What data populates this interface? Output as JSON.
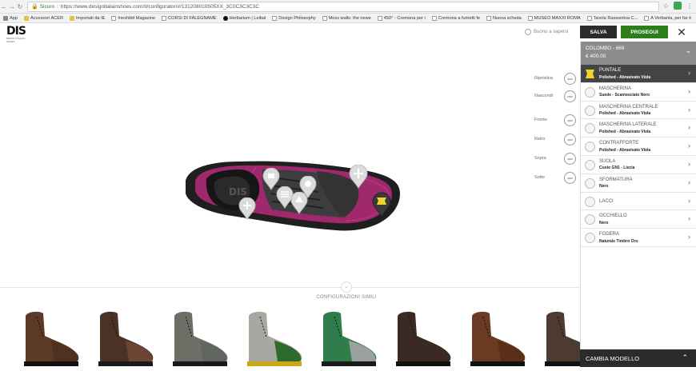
{
  "browser": {
    "secure_label": "Sicuro",
    "url": "https://www.designitalianshoes.com/it/configurator/#/131208010505XX_3C0C3C3C3C"
  },
  "bookmarks": [
    {
      "label": "App",
      "icon": "apps-grid-icon"
    },
    {
      "label": "Accessori ACER",
      "icon": "folder-icon"
    },
    {
      "label": "Importati da IE",
      "icon": "folder-icon"
    },
    {
      "label": "Inexhibit Magazine",
      "icon": "page-icon"
    },
    {
      "label": "CORSI DI FALEGNAME",
      "icon": "page-icon"
    },
    {
      "label": "Herbarium | Leibal",
      "icon": "dot-icon"
    },
    {
      "label": "Design Philosophy",
      "icon": "page-icon"
    },
    {
      "label": "Moss walls: the newe",
      "icon": "page-icon"
    },
    {
      "label": "450° - Cremona per i",
      "icon": "page-icon"
    },
    {
      "label": "Cremona a fumetti fe",
      "icon": "page-icon"
    },
    {
      "label": "Nuova scheda",
      "icon": "page-icon"
    },
    {
      "label": "MUSEO MAXXI ROMA",
      "icon": "google-icon"
    },
    {
      "label": "Tavola Rassuntiva C...",
      "icon": "page-icon"
    },
    {
      "label": "A Verbania, per far è",
      "icon": "page-icon"
    }
  ],
  "header": {
    "logo_text": "DIS",
    "logo_sub": "DESIGN ITALIAN SHOES",
    "buono_label": "Buono a sapersi",
    "salva_label": "SALVA",
    "prosegui_label": "PROSEGUI"
  },
  "tools": [
    {
      "label": "Ripristina",
      "icon": "reset-icon"
    },
    {
      "label": "Nascondi",
      "icon": "hide-pins-icon"
    },
    {
      "label": "Fronte",
      "icon": "view-front-icon"
    },
    {
      "label": "Retro",
      "icon": "view-back-icon"
    },
    {
      "label": "Sopra",
      "icon": "view-top-icon"
    },
    {
      "label": "Sotto",
      "icon": "view-bottom-icon"
    }
  ],
  "similar": {
    "title": "CONFIGURAZIONI SIMILI",
    "items": [
      {
        "upper": "#5b3a26",
        "toe": "#4e3121",
        "sole": "#111111"
      },
      {
        "upper": "#4a3226",
        "toe": "#6b4634",
        "sole": "#1a1a1a"
      },
      {
        "upper": "#6f6e66",
        "toe": "#5f6660",
        "sole": "#1a1a1a"
      },
      {
        "upper": "#a8a8a2",
        "toe": "#2d6a2b",
        "sole": "#c9a81c"
      },
      {
        "upper": "#2e7d4a",
        "toe": "#9aa0a0",
        "sole": "#1a1a1a"
      },
      {
        "upper": "#3a2a23",
        "toe": "#3a2a23",
        "sole": "#111111"
      },
      {
        "upper": "#6b3a22",
        "toe": "#5a2e1a",
        "sole": "#111111"
      },
      {
        "upper": "#4d3a30",
        "toe": "#4d3a30",
        "sole": "#111111"
      }
    ]
  },
  "panel": {
    "model": "COLOMBO - 669",
    "price": "€ 400,00",
    "options": [
      {
        "name": "PUNTALE",
        "value": "Polished - Abrasivato Viola",
        "active": true
      },
      {
        "name": "MASCHERINA",
        "value": "Suede - Scamosciato Nero"
      },
      {
        "name": "MASCHERINA CENTRALE",
        "value": "Polished - Abrasivato Viola"
      },
      {
        "name": "MASCHERINA LATERALE",
        "value": "Polished - Abrasivato Viola"
      },
      {
        "name": "CONTRAFFORTE",
        "value": "Polished - Abrasivato Viola"
      },
      {
        "name": "SUOLA",
        "value": "Cuoio GN1 - Liscia"
      },
      {
        "name": "SFORMATURA",
        "value": "Nero"
      },
      {
        "name": "LACCI",
        "value": ""
      },
      {
        "name": "OCCHIELLO",
        "value": "Nero"
      },
      {
        "name": "FODERA",
        "value": "Naturale Timbro Oro"
      }
    ],
    "cambia_label": "CAMBIA MODELLO"
  },
  "colors": {
    "accent_green": "#2e7d1b",
    "dark": "#2b2b2b",
    "purple_leather": "#a0286d",
    "highlight_yellow": "#f3d52a"
  }
}
